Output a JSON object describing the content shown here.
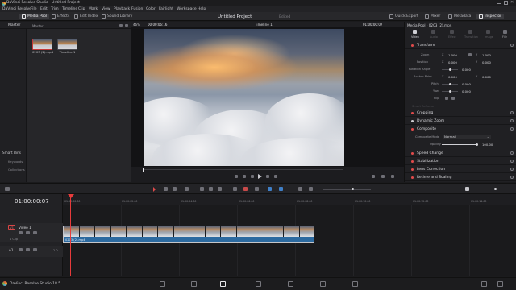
{
  "titlebar": {
    "app_title": "DaVinci Resolve Studio - Untitled Project"
  },
  "menu": [
    "DaVinci Resolve",
    "File",
    "Edit",
    "Trim",
    "Timeline",
    "Clip",
    "Mark",
    "View",
    "Playback",
    "Fusion",
    "Color",
    "Fairlight",
    "Workspace",
    "Help"
  ],
  "toolbar": {
    "media_pool": "Media Pool",
    "effects": "Effects",
    "edit_index": "Edit Index",
    "sound_library": "Sound Library",
    "project_title": "Untitled Project",
    "edited": "Edited",
    "quick_export": "Quick Export",
    "mixer": "Mixer",
    "metadata": "Metadata",
    "inspector": "Inspector"
  },
  "media_pool": {
    "master_tab": "Master",
    "master_bin": "Master",
    "clips": [
      {
        "name": "0203 (2).mp4"
      },
      {
        "name": "Timeline 1"
      }
    ],
    "smart_bins": "Smart Bins",
    "keywords": "Keywords",
    "collections": "Collections"
  },
  "viewer": {
    "zoom": "46%",
    "source_timecode": "00:00:06:16",
    "timeline_name": "Timeline 1",
    "record_timecode": "01:00:00:07"
  },
  "inspector": {
    "clip_title": "Media Pool - 0203 (2).mp4",
    "tabs": [
      "Video",
      "Audio",
      "Effect",
      "Transition",
      "Image",
      "File"
    ],
    "transform": {
      "label": "Transform",
      "params": [
        {
          "name": "Zoom",
          "x_label": "X",
          "x": "1.000",
          "y_label": "Y",
          "y": "1.000"
        },
        {
          "name": "Position",
          "x_label": "X",
          "x": "0.000",
          "y_label": "Y",
          "y": "0.000"
        },
        {
          "name": "Rotation Angle",
          "value": "0.000"
        },
        {
          "name": "Anchor Point",
          "x_label": "X",
          "x": "0.000",
          "y_label": "Y",
          "y": "0.000"
        },
        {
          "name": "Pitch",
          "value": "0.000"
        },
        {
          "name": "Yaw",
          "value": "0.000"
        },
        {
          "name": "Flip"
        }
      ]
    },
    "smart_reframe": "Smart Reframe",
    "sections": [
      "Cropping",
      "Dynamic Zoom",
      "Composite"
    ],
    "composite": {
      "mode_label": "Composite Mode",
      "mode_value": "Normal",
      "opacity_label": "Opacity",
      "opacity_value": "100.00"
    },
    "sections2": [
      "Speed Change",
      "Stabilization",
      "Lens Correction",
      "Retime and Scaling"
    ]
  },
  "timeline": {
    "timecode": "01:00:00:07",
    "ruler_ticks": [
      "01:00:00:00",
      "01:00:02:00",
      "01:00:04:00",
      "01:00:06:00",
      "01:00:08:00",
      "01:00:10:00",
      "01:00:12:00",
      "01:00:14:00"
    ],
    "v1_tag": "V1",
    "v1_name": "Video 1",
    "v1_count": "1 Clip",
    "a1_tag": "A1",
    "a1_level": "2.0",
    "clip_name": "0203 (2).mp4"
  },
  "footer": {
    "app": "DaVinci Resolve Studio 18.5"
  },
  "colors": {
    "accent_red": "#e14b4b",
    "clip_blue": "#2c6aa0",
    "playhead": "#e63b3b"
  }
}
